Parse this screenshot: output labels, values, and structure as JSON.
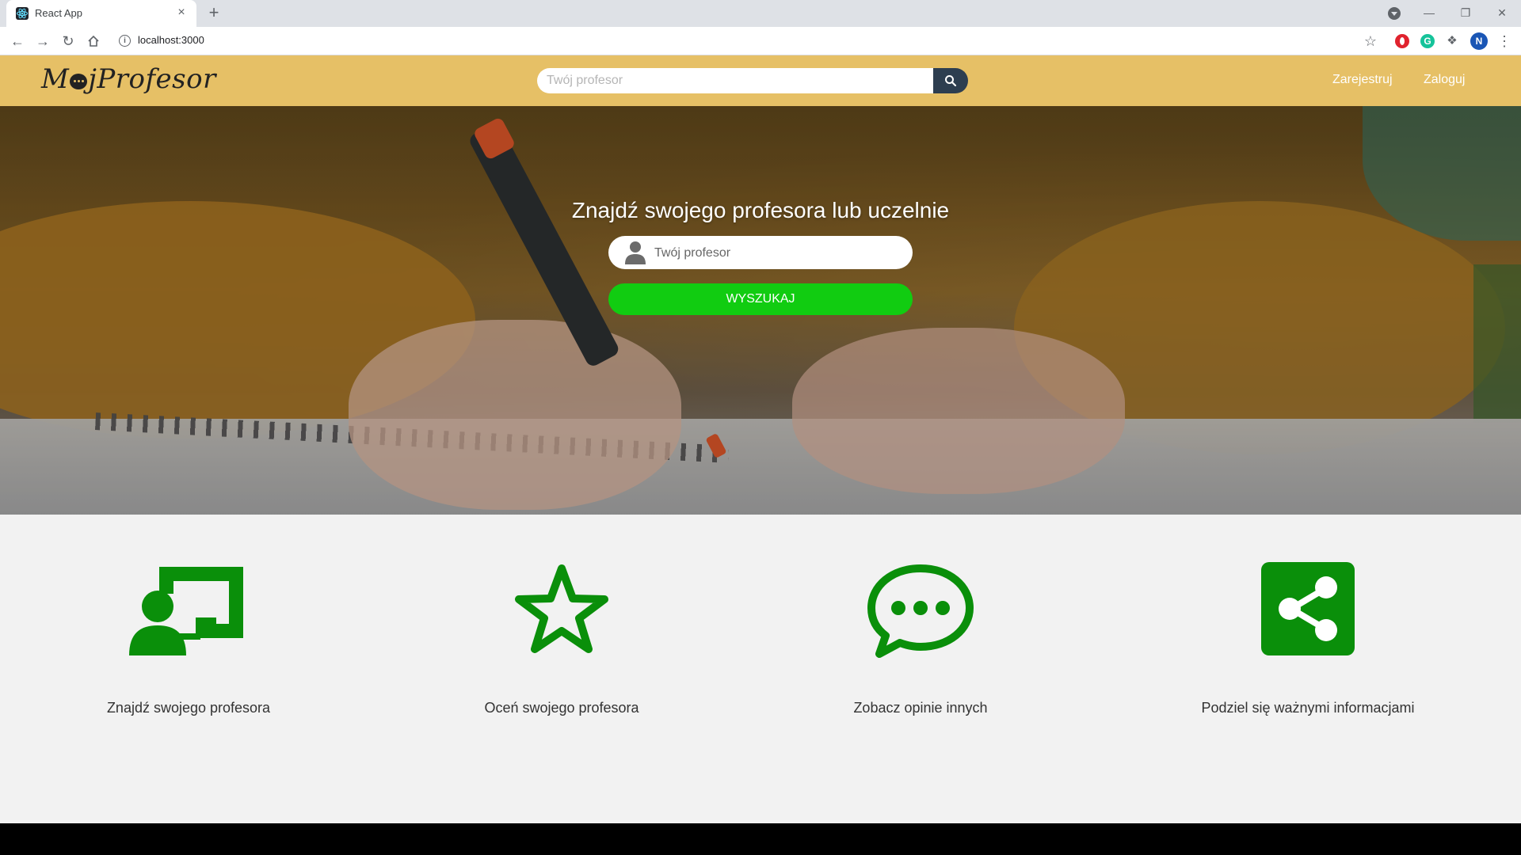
{
  "browser": {
    "tab_title": "React App",
    "tab_close": "×",
    "new_tab": "+",
    "url": "localhost:3000",
    "avatar_letter": "N"
  },
  "header": {
    "logo_prefix": "M",
    "logo_suffix": "jProfesor",
    "search_placeholder": "Twój profesor",
    "nav": {
      "register": "Zarejestruj",
      "login": "Zaloguj"
    }
  },
  "hero": {
    "title": "Znajdź swojego profesora lub uczelnie",
    "search_placeholder": "Twój profesor",
    "search_button": "WYSZUKAJ"
  },
  "features": [
    {
      "icon": "teacher-icon",
      "label": "Znajdź swojego profesora"
    },
    {
      "icon": "star-icon",
      "label": "Oceń swojego profesora"
    },
    {
      "icon": "comment-icon",
      "label": "Zobacz opinie innych"
    },
    {
      "icon": "share-icon",
      "label": "Podziel się ważnymi informacjami"
    }
  ],
  "colors": {
    "header_bg": "#e6c066",
    "search_button_bg": "#2d3e50",
    "accent_green": "#11cc11",
    "icon_green": "#0a8f0a"
  }
}
